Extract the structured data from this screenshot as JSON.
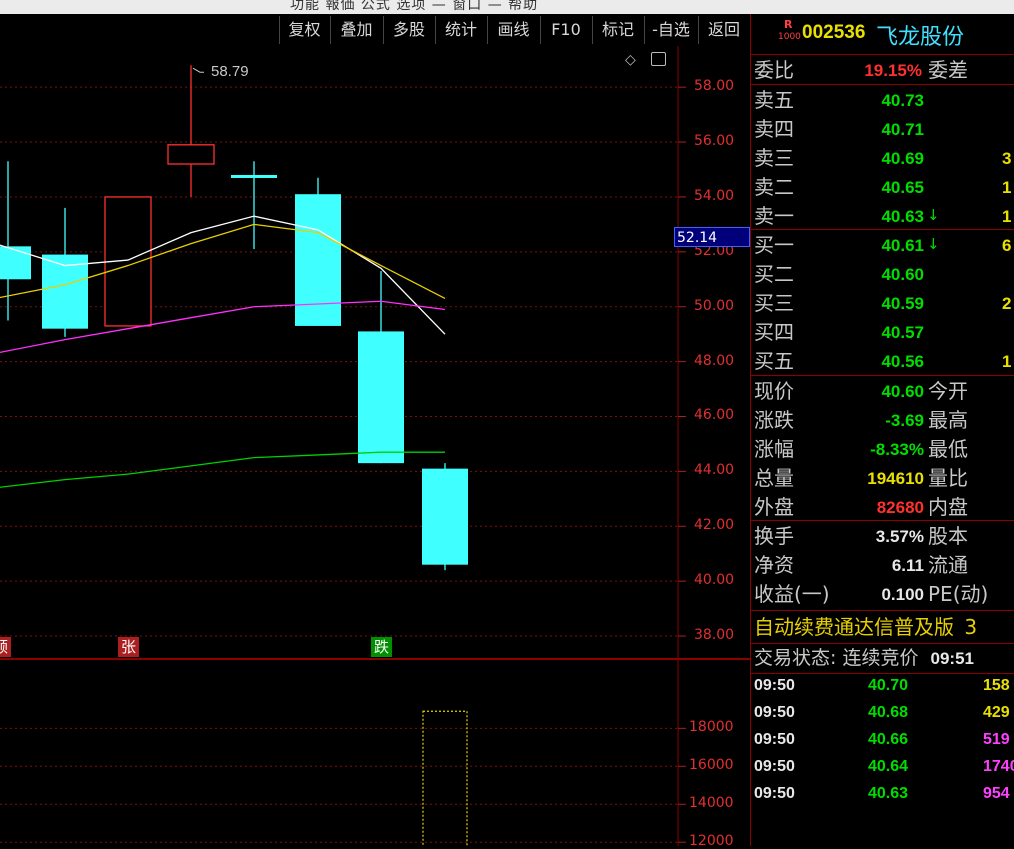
{
  "menubar": {
    "text": "功能   報価   公式   选项   —   窗口   —   帮助"
  },
  "toolbar": {
    "buttons": [
      "复权",
      "叠加",
      "多股",
      "统计",
      "画线",
      "F10",
      "标记",
      "-自选",
      "返回"
    ]
  },
  "stock": {
    "badge_top": "R",
    "badge_bottom": "1000",
    "code": "002536",
    "name": "飞龙股份"
  },
  "order_book": {
    "weibi_label": "委比",
    "weibi_value": "19.15%",
    "weicha_label": "委差",
    "asks": [
      {
        "label": "卖五",
        "price": "40.73",
        "qty": ""
      },
      {
        "label": "卖四",
        "price": "40.71",
        "qty": ""
      },
      {
        "label": "卖三",
        "price": "40.69",
        "qty": "3"
      },
      {
        "label": "卖二",
        "price": "40.65",
        "qty": "1"
      },
      {
        "label": "卖一",
        "price": "40.63",
        "qty": "1",
        "arrow": "↓"
      }
    ],
    "bids": [
      {
        "label": "买一",
        "price": "40.61",
        "qty": "6",
        "arrow": "↓"
      },
      {
        "label": "买二",
        "price": "40.60",
        "qty": ""
      },
      {
        "label": "买三",
        "price": "40.59",
        "qty": "2"
      },
      {
        "label": "买四",
        "price": "40.57",
        "qty": ""
      },
      {
        "label": "买五",
        "price": "40.56",
        "qty": "1"
      }
    ]
  },
  "quote": {
    "rows": [
      {
        "label": "现价",
        "value": "40.60",
        "color": "green",
        "label2": "今开"
      },
      {
        "label": "涨跌",
        "value": "-3.69",
        "color": "green",
        "label2": "最高"
      },
      {
        "label": "涨幅",
        "value": "-8.33%",
        "color": "green",
        "label2": "最低"
      },
      {
        "label": "总量",
        "value": "194610",
        "color": "yellow",
        "label2": "量比"
      },
      {
        "label": "外盘",
        "value": "82680",
        "color": "red",
        "label2": "内盘"
      }
    ],
    "rows2": [
      {
        "label": "换手",
        "value": "3.57%",
        "label2": "股本"
      },
      {
        "label": "净资",
        "value": "6.11",
        "label2": "流通"
      },
      {
        "label": "收益(一)",
        "value": "0.100",
        "label2": "PE(动)"
      }
    ],
    "ticker": "自动续费通达信普及版",
    "ticker_tail": "3",
    "trade_status": "交易状态: 连续竞价",
    "trade_time": "09:51"
  },
  "ticks": [
    {
      "time": "09:50",
      "price": "40.70",
      "vol": "158",
      "color": "#e8e000"
    },
    {
      "time": "09:50",
      "price": "40.68",
      "vol": "429",
      "color": "#e8e000"
    },
    {
      "time": "09:50",
      "price": "40.66",
      "vol": "519",
      "color": "#ff40ff"
    },
    {
      "time": "09:50",
      "price": "40.64",
      "vol": "1740",
      "color": "#ff40ff"
    },
    {
      "time": "09:50",
      "price": "40.63",
      "vol": "954",
      "color": "#ff40ff"
    }
  ],
  "chart_data": {
    "type": "candlestick",
    "price_axis": [
      "58.00",
      "56.00",
      "54.00",
      "52.00",
      "50.00",
      "48.00",
      "46.00",
      "44.00",
      "42.00",
      "40.00",
      "38.00"
    ],
    "ylim": [
      37.2,
      59.5
    ],
    "current_price_tag": "52.14",
    "max_annotation": "58.79",
    "candles": [
      {
        "open": 51.0,
        "close": 52.2,
        "high": 55.3,
        "low": 49.5,
        "up": false,
        "clipped": true
      },
      {
        "open": 51.9,
        "close": 49.2,
        "high": 53.6,
        "low": 48.9,
        "up": false
      },
      {
        "open": 49.3,
        "close": 54.0,
        "high": 54.0,
        "low": 49.3,
        "up": true
      },
      {
        "open": 55.2,
        "close": 55.9,
        "high": 58.8,
        "low": 54.0,
        "up": true
      },
      {
        "open": 54.7,
        "close": 54.8,
        "high": 55.3,
        "low": 52.1,
        "up": false
      },
      {
        "open": 54.1,
        "close": 49.3,
        "high": 54.7,
        "low": 49.3,
        "up": false
      },
      {
        "open": 49.1,
        "close": 44.3,
        "high": 51.3,
        "low": 44.3,
        "up": false
      },
      {
        "open": 44.1,
        "close": 40.6,
        "high": 44.3,
        "low": 40.4,
        "up": false
      }
    ],
    "ma_lines": [
      {
        "color": "#ffffff",
        "values": [
          52.3,
          51.5,
          51.7,
          52.7,
          53.3,
          52.8,
          51.4,
          49.0
        ]
      },
      {
        "color": "#e8d000",
        "values": [
          50.3,
          50.8,
          51.5,
          52.3,
          53.0,
          52.7,
          51.5,
          50.3
        ]
      },
      {
        "color": "#ff30ff",
        "values": [
          48.3,
          48.8,
          49.2,
          49.6,
          50.0,
          50.1,
          50.2,
          49.9
        ]
      },
      {
        "color": "#00d000",
        "values": [
          43.4,
          43.7,
          43.9,
          44.2,
          44.5,
          44.6,
          44.7,
          44.7
        ]
      }
    ],
    "markers": [
      {
        "text": "顿",
        "color": "#aa2020",
        "index": 0
      },
      {
        "text": "张",
        "color": "#aa2020",
        "index": 2
      },
      {
        "text": "跌",
        "color": "#009000",
        "index": 6
      }
    ],
    "volume_axis": [
      "18000",
      "16000",
      "14000",
      "12000"
    ],
    "volume_ylim": [
      11800,
      21600
    ],
    "volume_bars": [
      {
        "index": 7,
        "value": 18900
      }
    ]
  }
}
